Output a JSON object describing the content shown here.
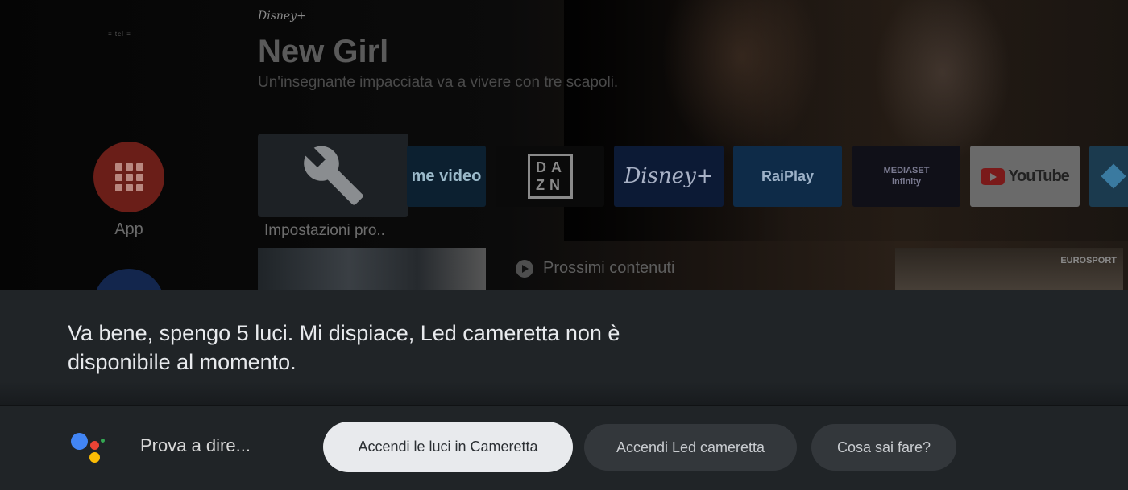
{
  "home": {
    "device_logo_text": "≡ tcl ≡",
    "featured": {
      "brand": "Disney+",
      "title": "New Girl",
      "description": "Un'insegnante impacciata va a vivere con tre scapoli."
    },
    "apps_label": "App",
    "focused_app_label": "Impostazioni pro..",
    "apps": [
      {
        "name": "prime video",
        "label": "me video"
      },
      {
        "name": "DAZN",
        "label": "DA ZN"
      },
      {
        "name": "Disney+",
        "label": "Disney+"
      },
      {
        "name": "RaiPlay",
        "label": "RaiPlay"
      },
      {
        "name": "Mediaset Infinity",
        "label": "MEDIASET infinity"
      },
      {
        "name": "YouTube",
        "label": "YouTube"
      },
      {
        "name": "Kodi",
        "label": ""
      }
    ],
    "upcoming_label": "Prossimi contenuti",
    "right_thumb_badge": "EUROSPORT"
  },
  "assistant": {
    "response": "Va bene, spengo 5 luci. Mi dispiace, Led cameretta non è disponibile al momento.",
    "prompt_label": "Prova a dire...",
    "suggestions": [
      "Accendi le luci in Cameretta",
      "Accendi Led cameretta",
      "Cosa sai fare?"
    ],
    "colors": {
      "blue": "#4285F4",
      "red": "#EA4335",
      "yellow": "#FBBC05",
      "green": "#34A853"
    }
  }
}
